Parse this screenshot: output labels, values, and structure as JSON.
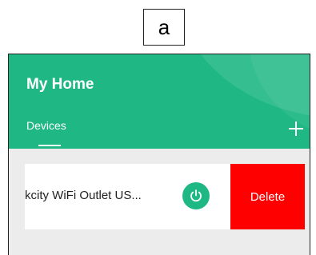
{
  "figure_label": "a",
  "header": {
    "title": "My Home",
    "tab_label": "Devices",
    "add_icon": "plus-icon"
  },
  "device_row": {
    "name": "kcity  WiFi Outlet US...",
    "power_icon": "power-icon",
    "delete_label": "Delete"
  },
  "colors": {
    "brand_green": "#1fb884",
    "delete_red": "#ff0000",
    "list_background": "#ececec"
  }
}
